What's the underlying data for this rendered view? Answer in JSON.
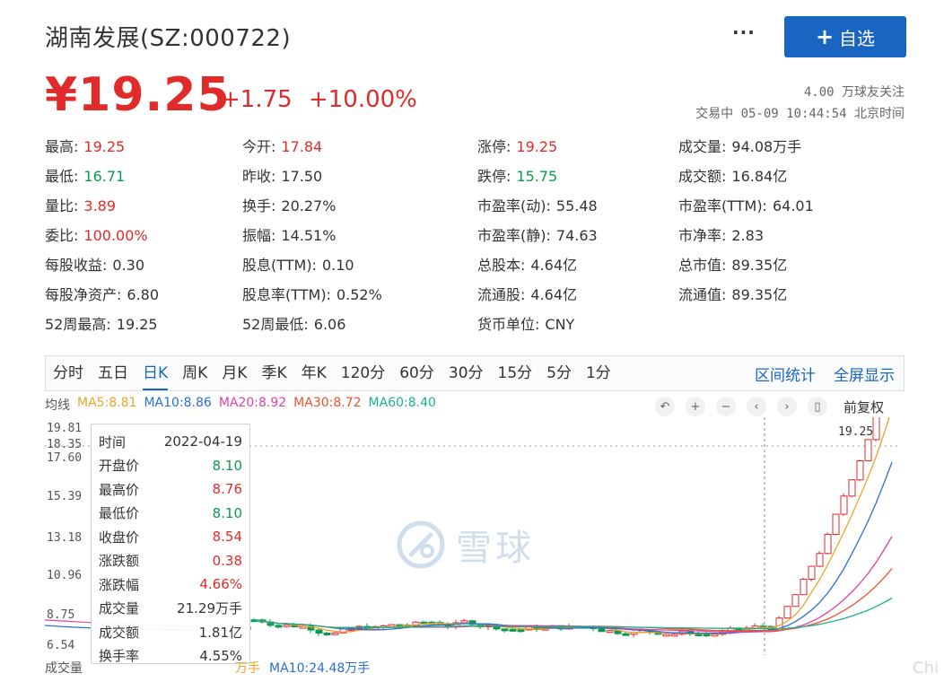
{
  "header": {
    "title": "湖南发展(SZ:000722)",
    "more_label": "···",
    "add_label": "自选",
    "price": "¥19.25",
    "change": "+1.75",
    "change_pct": "+10.00%",
    "followers": "4.00 万球友关注",
    "trade_status": "交易中 05-09 10:44:54 北京时间"
  },
  "quote": [
    [
      {
        "label": "最高:",
        "value": "19.25",
        "color": "up"
      },
      {
        "label": "今开:",
        "value": "17.84",
        "color": "up"
      },
      {
        "label": "涨停:",
        "value": "19.25",
        "color": "up"
      },
      {
        "label": "成交量:",
        "value": "94.08万手",
        "color": "none"
      }
    ],
    [
      {
        "label": "最低:",
        "value": "16.71",
        "color": "down"
      },
      {
        "label": "昨收:",
        "value": "17.50",
        "color": "none"
      },
      {
        "label": "跌停:",
        "value": "15.75",
        "color": "down"
      },
      {
        "label": "成交额:",
        "value": "16.84亿",
        "color": "none"
      }
    ],
    [
      {
        "label": "量比:",
        "value": "3.89",
        "color": "up"
      },
      {
        "label": "换手:",
        "value": "20.27%",
        "color": "none"
      },
      {
        "label": "市盈率(动):",
        "value": "55.48",
        "color": "none"
      },
      {
        "label": "市盈率(TTM):",
        "value": "64.01",
        "color": "none"
      }
    ],
    [
      {
        "label": "委比:",
        "value": "100.00%",
        "color": "up"
      },
      {
        "label": "振幅:",
        "value": "14.51%",
        "color": "none"
      },
      {
        "label": "市盈率(静):",
        "value": "74.63",
        "color": "none"
      },
      {
        "label": "市净率:",
        "value": "2.83",
        "color": "none"
      }
    ],
    [
      {
        "label": "每股收益:",
        "value": "0.30",
        "color": "none"
      },
      {
        "label": "股息(TTM):",
        "value": "0.10",
        "color": "none"
      },
      {
        "label": "总股本:",
        "value": "4.64亿",
        "color": "none"
      },
      {
        "label": "总市值:",
        "value": "89.35亿",
        "color": "none"
      }
    ],
    [
      {
        "label": "每股净资产:",
        "value": "6.80",
        "color": "none"
      },
      {
        "label": "股息率(TTM):",
        "value": "0.52%",
        "color": "none"
      },
      {
        "label": "流通股:",
        "value": "4.64亿",
        "color": "none"
      },
      {
        "label": "流通值:",
        "value": "89.35亿",
        "color": "none"
      }
    ],
    [
      {
        "label": "52周最高:",
        "value": "19.25",
        "color": "none"
      },
      {
        "label": "52周最低:",
        "value": "6.06",
        "color": "none"
      },
      {
        "label": "货币单位:",
        "value": "CNY",
        "color": "none"
      },
      null
    ]
  ],
  "periods": [
    "分时",
    "五日",
    "日K",
    "周K",
    "月K",
    "季K",
    "年K",
    "120分",
    "60分",
    "30分",
    "15分",
    "5分",
    "1分"
  ],
  "active_period": "日K",
  "period_links": [
    "区间统计",
    "全屏显示"
  ],
  "ma": {
    "label": "均线",
    "items": [
      {
        "text": "MA5:8.81",
        "color": "#f0a32a"
      },
      {
        "text": "MA10:8.86",
        "color": "#2a6fd6"
      },
      {
        "text": "MA20:8.92",
        "color": "#e040a0"
      },
      {
        "text": "MA30:8.72",
        "color": "#e8552f"
      },
      {
        "text": "MA60:8.40",
        "color": "#19b38a"
      }
    ]
  },
  "controls": {
    "icons": [
      "undo-icon",
      "zoom-in-icon",
      "zoom-out-icon",
      "prev-icon",
      "next-icon",
      "restore-icon"
    ],
    "glyphs": [
      "↶",
      "+",
      "−",
      "‹",
      "›",
      "▯"
    ],
    "adjust_label": "前复权"
  },
  "yaxis": [
    "19.81",
    "18.35",
    "17.60",
    "15.39",
    "13.18",
    "10.96",
    "8.75",
    "6.54"
  ],
  "last_price_label": "19.25",
  "tooltip": [
    {
      "k": "时间",
      "v": "2022-04-19",
      "color": "none"
    },
    {
      "k": "开盘价",
      "v": "8.10",
      "color": "down"
    },
    {
      "k": "最高价",
      "v": "8.76",
      "color": "up"
    },
    {
      "k": "最低价",
      "v": "8.10",
      "color": "down"
    },
    {
      "k": "收盘价",
      "v": "8.54",
      "color": "up"
    },
    {
      "k": "涨跌额",
      "v": "0.38",
      "color": "up"
    },
    {
      "k": "涨跌幅",
      "v": "4.66%",
      "color": "up"
    },
    {
      "k": "成交量",
      "v": "21.29万手",
      "color": "none"
    },
    {
      "k": "成交额",
      "v": "1.81亿",
      "color": "none"
    },
    {
      "k": "换手率",
      "v": "4.55%",
      "color": "none"
    }
  ],
  "volume": {
    "label": "成交量",
    "ma5": "万手",
    "ma10": "MA10:24.48万手"
  },
  "watermark": "雪球",
  "corner_mark": "Chi"
}
